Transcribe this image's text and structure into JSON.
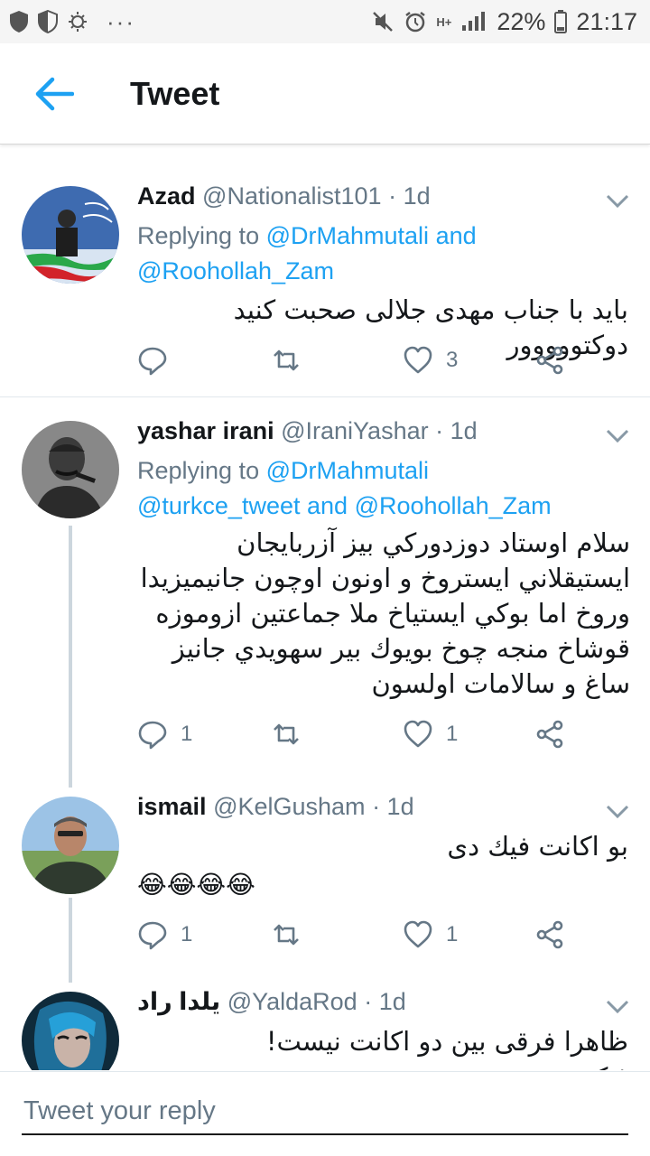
{
  "status_bar": {
    "battery": "22%",
    "time": "21:17",
    "network": "H+",
    "dots": "···"
  },
  "header": {
    "title": "Tweet"
  },
  "tweets": [
    {
      "name": "Azad",
      "handle": "@Nationalist101",
      "time": "· 1d",
      "replying_prefix": "Replying to",
      "mention1": "@DrMahmutali",
      "and_word": "and",
      "mention2": "@Roohollah_Zam",
      "body": "باید با جناب مهدی جلالی صحبت کنید دوکتووووور",
      "replies": "",
      "retweets": "",
      "likes": "3"
    },
    {
      "name": "yashar irani",
      "handle": "@IraniYashar",
      "time": "· 1d",
      "replying_prefix": "Replying to",
      "mention1": "@DrMahmutali",
      "mention2": "@turkce_tweet",
      "and_word": "and",
      "mention3": "@Roohollah_Zam",
      "body": "سلام اوستاد دوزدوركي بيز آزربايجان ايستيقلاني ايستروخ و اونون اوچون جانيميزيدا وروخ اما بوكي ايستياخ ملا جماعتين ازوموزه قوشاخ منجه چوخ بويوك بير سهويدي جانيز ساغ و سالامات اولسون",
      "replies": "1",
      "retweets": "",
      "likes": "1"
    },
    {
      "name": "ismail",
      "handle": "@KelGusham",
      "time": "· 1d",
      "body": "بو اكانت فيك دى",
      "emojis": "😂😂😂😂",
      "replies": "1",
      "retweets": "",
      "likes": "1"
    },
    {
      "name": "یلدا راد",
      "handle": "@YaldaRod",
      "time": "· 1d",
      "body": "ظاهرا فرقی بین دو اکانت نیست!",
      "body_cut": "فیک"
    }
  ],
  "reply_bar": {
    "placeholder": "Tweet your reply"
  },
  "colors": {
    "accent": "#1da1f2",
    "muted": "#657786",
    "thread": "#ccd6dd"
  }
}
